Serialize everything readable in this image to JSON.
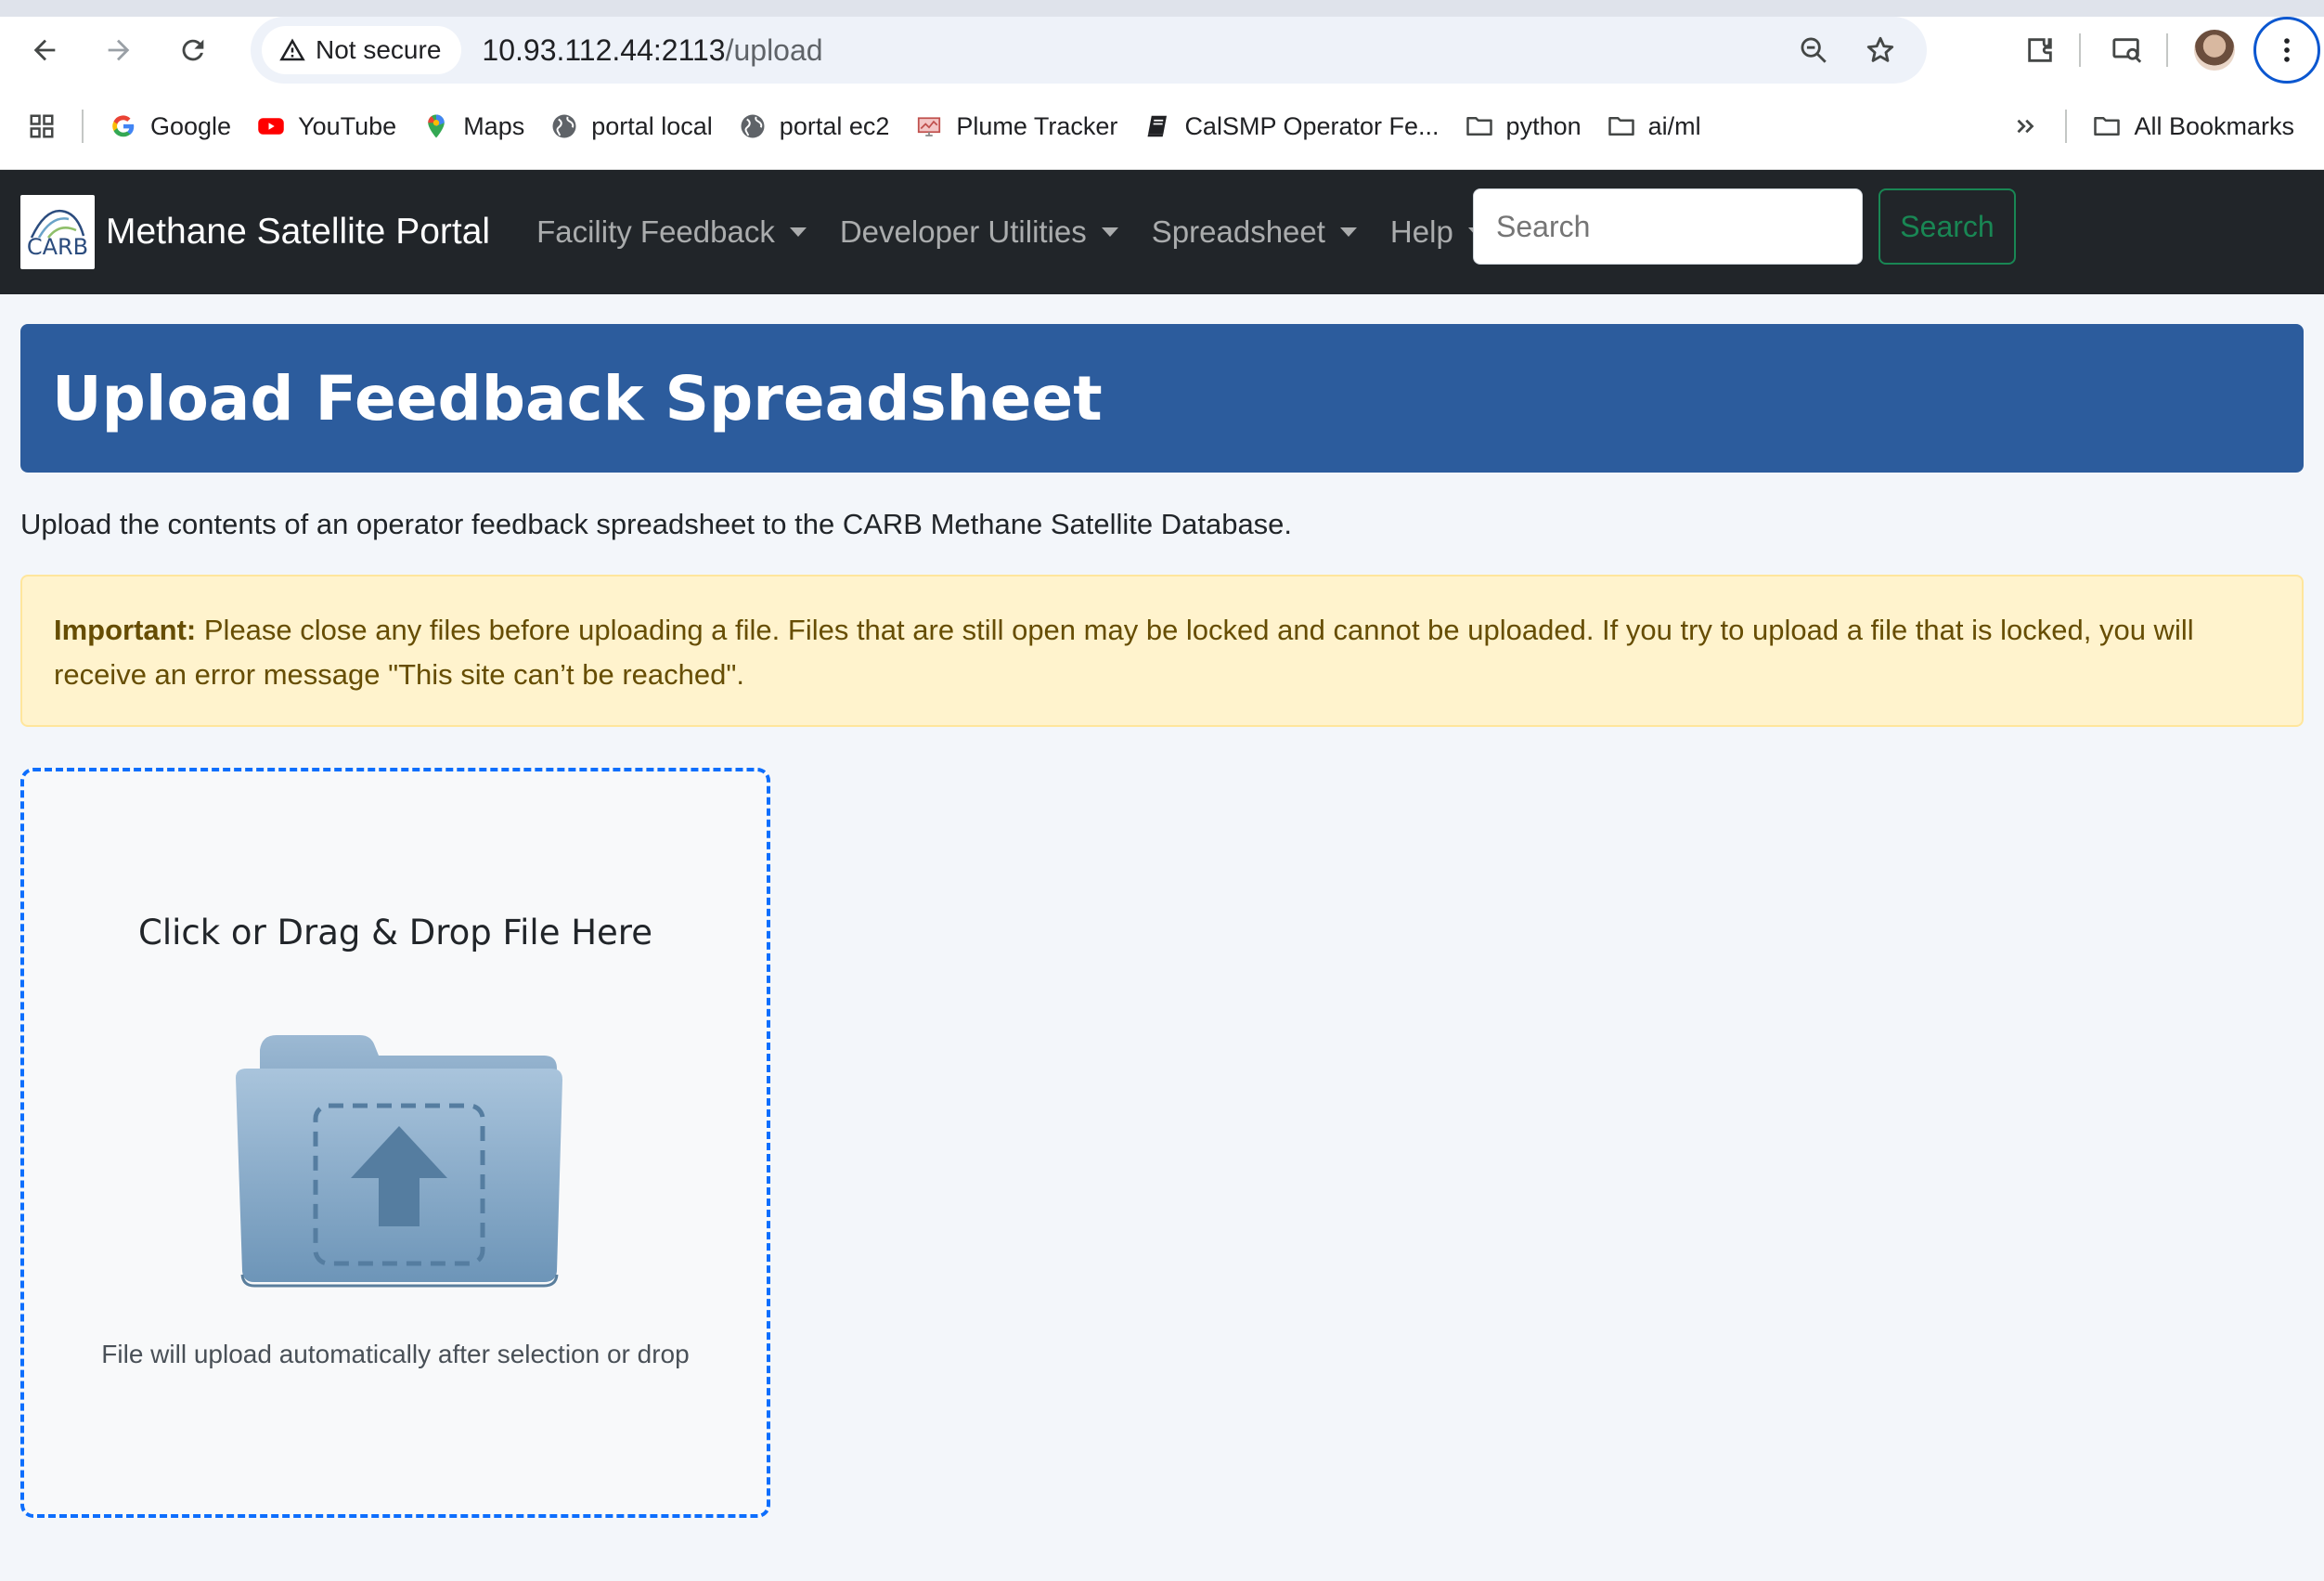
{
  "browser": {
    "security_label": "Not secure",
    "url_host": "10.93.112.44:2113",
    "url_path": "/upload"
  },
  "bookmarks": {
    "items": [
      {
        "label": "Google",
        "icon": "google-icon"
      },
      {
        "label": "YouTube",
        "icon": "youtube-icon"
      },
      {
        "label": "Maps",
        "icon": "maps-icon"
      },
      {
        "label": "portal local",
        "icon": "globe-icon"
      },
      {
        "label": "portal ec2",
        "icon": "globe-icon"
      },
      {
        "label": "Plume Tracker",
        "icon": "plume-tracker-icon"
      },
      {
        "label": "CalSMP Operator Fe...",
        "icon": "book-icon"
      },
      {
        "label": "python",
        "icon": "folder-icon"
      },
      {
        "label": "ai/ml",
        "icon": "folder-icon"
      }
    ],
    "all_label": "All Bookmarks"
  },
  "navbar": {
    "logo_text": "CARB",
    "brand": "Methane Satellite Portal",
    "links": [
      {
        "label": "Facility Feedback"
      },
      {
        "label": "Developer Utilities"
      },
      {
        "label": "Spreadsheet"
      },
      {
        "label": "Help"
      }
    ],
    "search_placeholder": "Search",
    "search_button": "Search"
  },
  "main": {
    "title": "Upload Feedback Spreadsheet",
    "lead": "Upload the contents of an operator feedback spreadsheet to the CARB Methane Satellite Database.",
    "alert_strong": "Important:",
    "alert_text": " Please close any files before uploading a file. Files that are still open may be locked and cannot be uploaded. If you try to upload a file that is locked, you will receive an error message \"This site can’t be reached\".",
    "dropzone_title": "Click or Drag & Drop File Here",
    "dropzone_hint": "File will upload automatically after selection or drop"
  },
  "colors": {
    "navbar_bg": "#212529",
    "title_bg": "#2c5c9d",
    "alert_bg": "#fff3cd",
    "search_btn": "#198754",
    "dropzone_border": "#0d6efd"
  }
}
